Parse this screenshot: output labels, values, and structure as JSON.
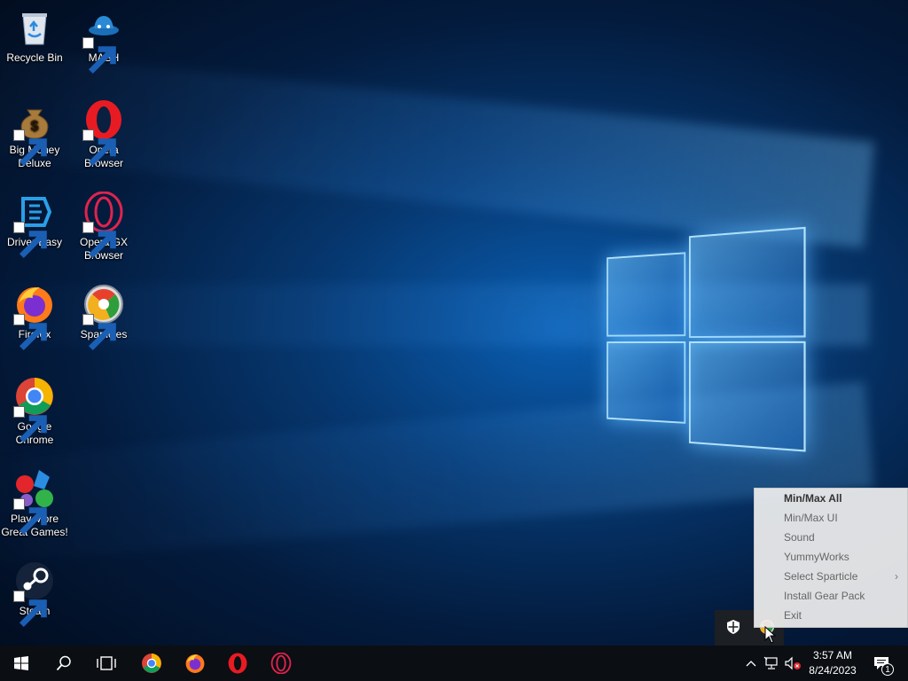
{
  "desktop": {
    "icons": [
      {
        "label": "Recycle Bin",
        "icon": "recycle-bin-icon"
      },
      {
        "label": "MASH",
        "icon": "mash-icon"
      },
      {
        "label": "Big Money Deluxe",
        "icon": "money-bag-icon"
      },
      {
        "label": "Opera Browser",
        "icon": "opera-icon"
      },
      {
        "label": "Driver Easy",
        "icon": "driver-easy-icon"
      },
      {
        "label": "Opera GX Browser",
        "icon": "opera-gx-icon"
      },
      {
        "label": "Firefox",
        "icon": "firefox-icon"
      },
      {
        "label": "Sparticles",
        "icon": "sparticles-icon"
      },
      {
        "label": "Google Chrome",
        "icon": "chrome-icon"
      },
      {
        "label": "Play More Great Games!",
        "icon": "games-icon"
      },
      {
        "label": "Steam",
        "icon": "steam-icon"
      }
    ]
  },
  "context_menu": {
    "items": [
      {
        "label": "Min/Max All"
      },
      {
        "label": "Min/Max UI"
      },
      {
        "label": "Sound"
      },
      {
        "label": "YummyWorks"
      },
      {
        "label": "Select Sparticle",
        "submenu_arrow": "›"
      },
      {
        "label": "Install Gear Pack"
      },
      {
        "label": "Exit"
      }
    ]
  },
  "taskbar": {
    "pinned": [
      "windows-start-icon",
      "search-icon",
      "task-view-icon",
      "chrome-icon",
      "firefox-icon",
      "opera-icon",
      "opera-gx-icon"
    ],
    "tray": {
      "time": "3:57 AM",
      "date": "8/24/2023",
      "notification_count": "1"
    }
  },
  "colors": {
    "taskbar": "#0b0e13",
    "opera_red": "#e81b23",
    "chrome_red": "#db4437",
    "chrome_green": "#0f9d58",
    "chrome_yellow": "#f4b400",
    "chrome_blue": "#4285f4"
  }
}
